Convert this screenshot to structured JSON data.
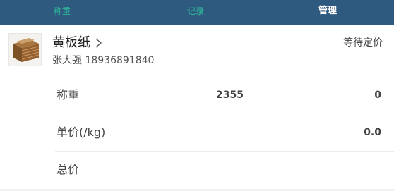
{
  "tabs": [
    {
      "label": "称重",
      "active": false
    },
    {
      "label": "记录",
      "active": false
    },
    {
      "label": "管理",
      "active": true
    }
  ],
  "colors": {
    "header_bg": "#2f5a7f",
    "tab_inactive": "#2ec19b",
    "tab_active": "#ffffff"
  },
  "product": {
    "name": "黄板纸",
    "contact": "张大强 18936891840",
    "status": "等待定价",
    "image_icon": "cardboard-box-image"
  },
  "weigh": {
    "label": "称重",
    "reading": "2355",
    "value": "0"
  },
  "unit_price": {
    "label": "单价(/kg)",
    "value": "0.0"
  },
  "total": {
    "label": "总价",
    "value": ""
  }
}
